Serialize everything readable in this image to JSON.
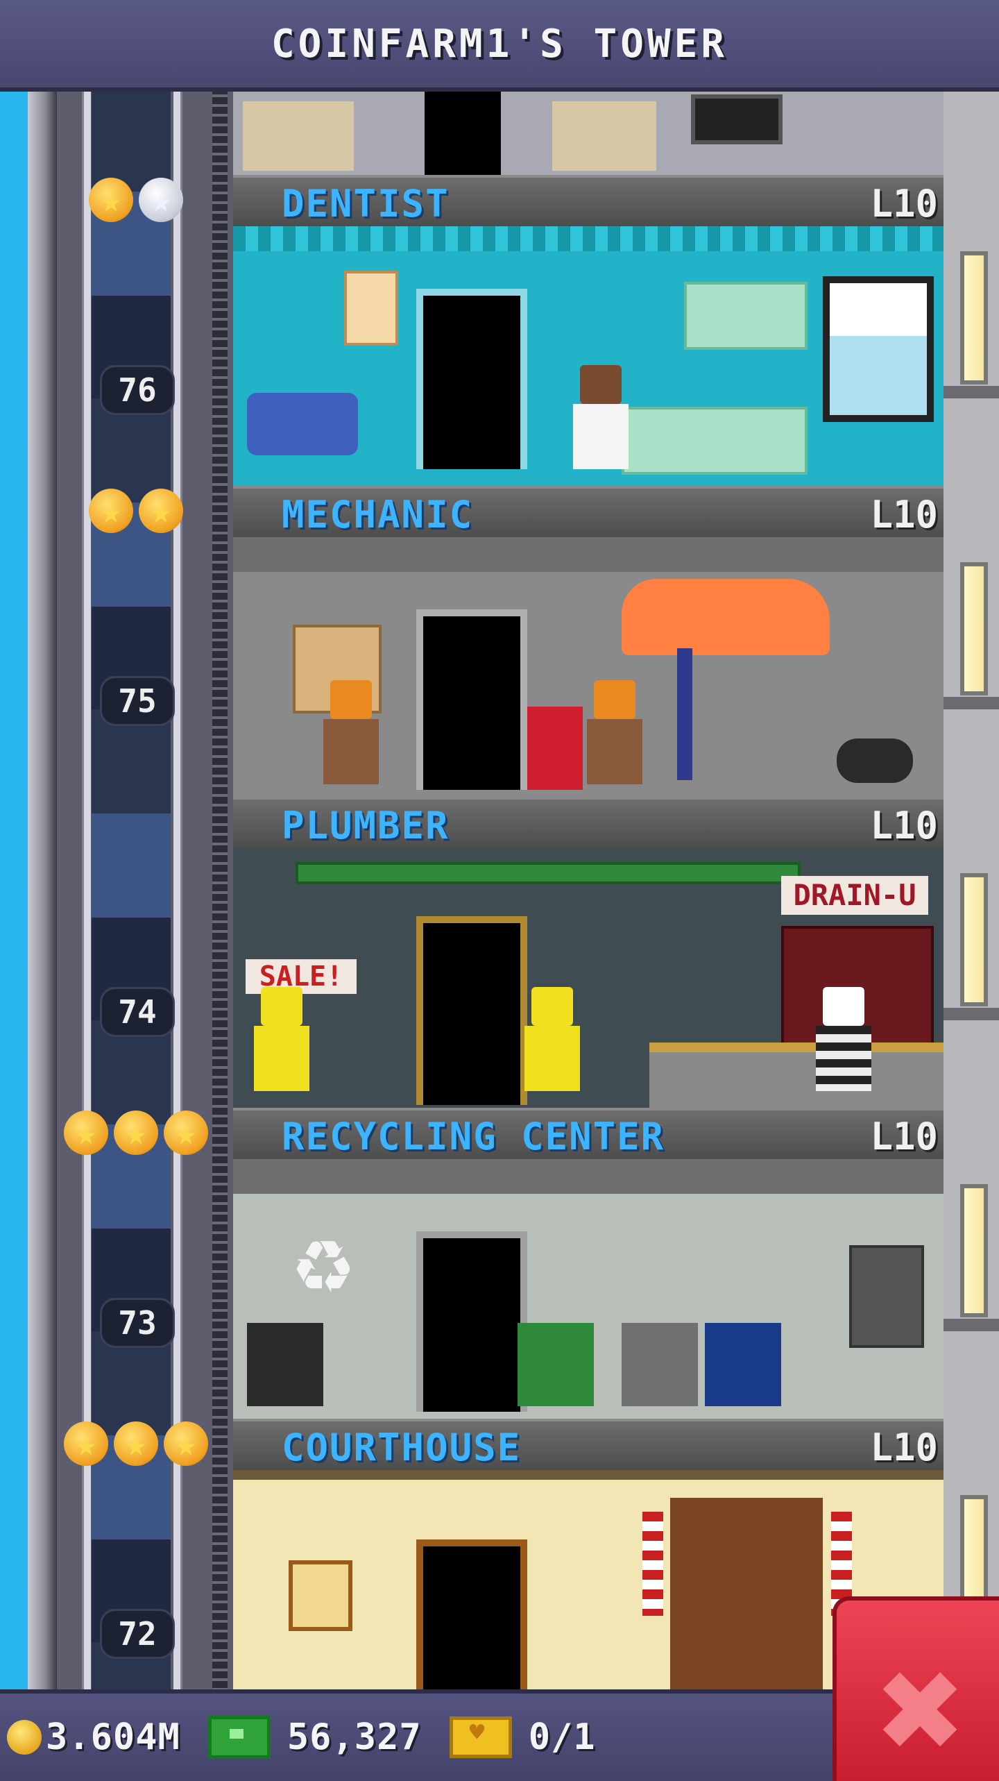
{
  "header": {
    "title": "COINFARM1'S TOWER"
  },
  "floors": [
    {
      "number": "",
      "name": "DENTIST",
      "level": "L10",
      "stars": [
        "gold",
        "silver"
      ],
      "accent": "#22b3c9"
    },
    {
      "number": "76",
      "name": "MECHANIC",
      "level": "L10",
      "stars": [
        "gold",
        "gold"
      ],
      "accent": "#8e8e8e"
    },
    {
      "number": "75",
      "name": "PLUMBER",
      "level": "L10",
      "stars": [],
      "accent": "#4c5a5e"
    },
    {
      "number": "74",
      "name": "RECYCLING CENTER",
      "level": "L10",
      "stars": [
        "gold",
        "gold",
        "gold"
      ],
      "accent": "#b8bfb8"
    },
    {
      "number": "73",
      "name": "COURTHOUSE",
      "level": "L10",
      "stars": [
        "gold",
        "gold",
        "gold"
      ],
      "accent": "#f3e6b5"
    },
    {
      "number": "72",
      "name": "",
      "level": "",
      "stars": [],
      "accent": ""
    }
  ],
  "signs": {
    "sale": "SALE!",
    "drain": "DRAIN-U"
  },
  "bottom_bar": {
    "coins": "3.604M",
    "bux": "56,327",
    "tickets": "0/1"
  },
  "icons": {
    "coin": "coin-icon",
    "bux": "tower-bux-icon",
    "ticket": "golden-ticket-icon",
    "close": "close-icon"
  },
  "colors": {
    "header": "#4e4e78",
    "floor_name": "#3cb4ff",
    "close_button": "#d92a3c"
  }
}
